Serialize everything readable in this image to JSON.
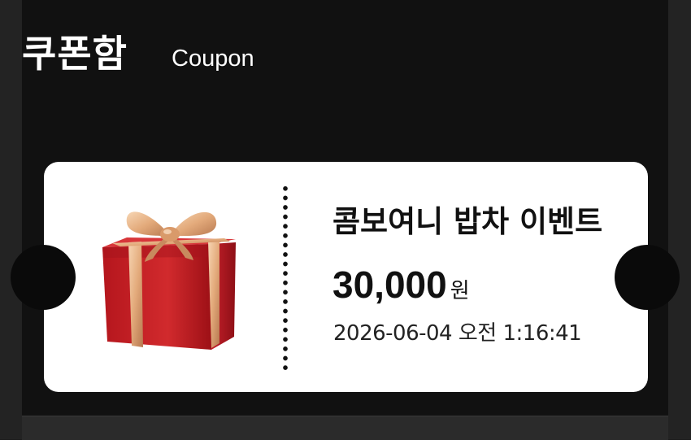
{
  "header": {
    "title_ko": "쿠폰함",
    "title_en": "Coupon"
  },
  "coupon": {
    "name": "콤보여니 밥차 이벤트",
    "amount": "30,000",
    "unit": "원",
    "datetime": "2026-06-04 오전 1:16:41",
    "image_icon": "gift-box-icon"
  },
  "colors": {
    "background": "#111111",
    "card": "#ffffff",
    "gift_red": "#c81e24",
    "ribbon_gold": "#e6b487"
  }
}
